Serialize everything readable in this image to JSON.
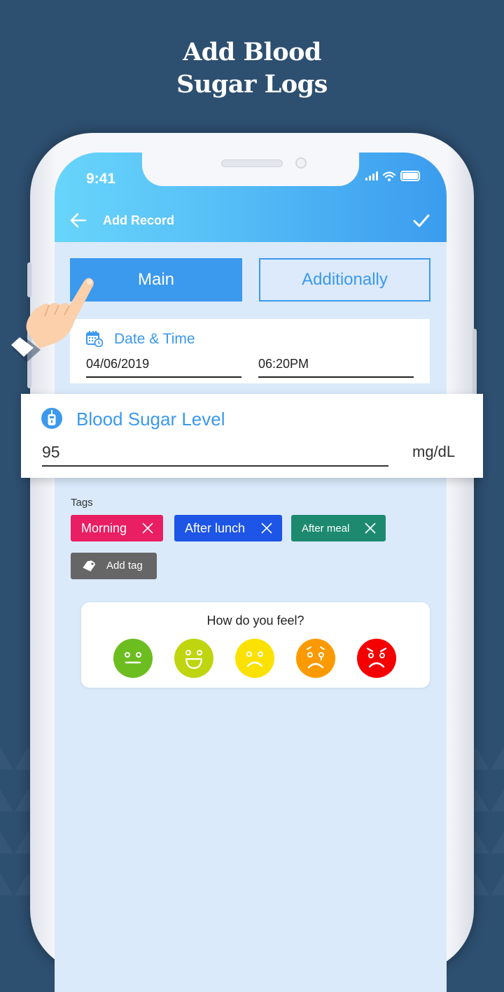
{
  "promo": {
    "headline_line1": "Add Blood",
    "headline_line2": "Sugar Logs"
  },
  "status_bar": {
    "time": "9:41",
    "icons": [
      "signal-icon",
      "wifi-icon",
      "battery-icon"
    ]
  },
  "toolbar": {
    "back_icon": "arrow-left-icon",
    "title": "Add Record",
    "confirm_icon": "check-icon"
  },
  "tabs": [
    {
      "label": "Main",
      "active": true
    },
    {
      "label": "Additionally",
      "active": false
    }
  ],
  "date_time": {
    "icon": "calendar-clock-icon",
    "title": "Date & Time",
    "date": "04/06/2019",
    "time": "06:20PM"
  },
  "blood_sugar": {
    "icon": "glucometer-icon",
    "title": "Blood Sugar Level",
    "value": "95",
    "unit": "mg/dL"
  },
  "tags": {
    "label": "Tags",
    "items": [
      {
        "label": "Morning",
        "color": "#e91e63"
      },
      {
        "label": "After lunch",
        "color": "#1d55e6"
      },
      {
        "label": "After meal",
        "color": "#1d8a70"
      }
    ],
    "add_label": "Add tag"
  },
  "feeling": {
    "title": "How do you feel?",
    "options": [
      {
        "name": "neutral",
        "color": "#6cbd1f"
      },
      {
        "name": "happy",
        "color": "#bed50f"
      },
      {
        "name": "sad",
        "color": "#fbe100"
      },
      {
        "name": "crying",
        "color": "#fb9a00"
      },
      {
        "name": "angry",
        "color": "#f50000"
      }
    ]
  },
  "colors": {
    "accent": "#3b99ee",
    "background": "#2d4f70",
    "screen_bg": "#daeafb"
  }
}
